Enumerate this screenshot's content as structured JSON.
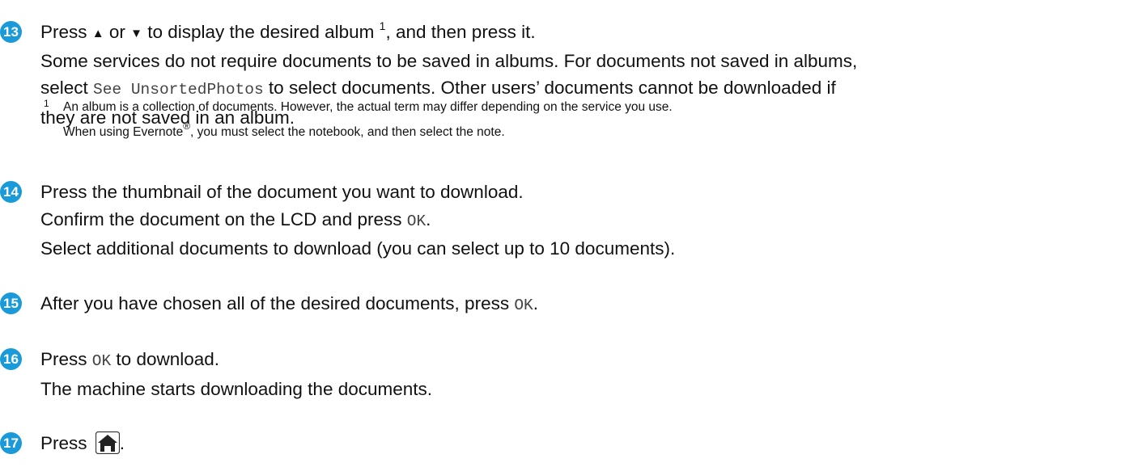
{
  "step13": {
    "number": "13",
    "l1_a": "Press ",
    "up_glyph": "▲",
    "l1_b": " or ",
    "down_glyph": "▼",
    "l1_c": " to display the desired album ",
    "l1_sup": "1",
    "l1_d": ", and then press it.",
    "l2": "Some services do not require documents to be saved in albums. For documents not saved in albums,",
    "l3_a": "select ",
    "l3_code": "See UnsortedPhotos",
    "l3_b": " to select documents. Other users’ documents cannot be downloaded if",
    "l4": "they are not saved in an album."
  },
  "footnote": {
    "number": "1",
    "line1": "An album is a collection of documents. However, the actual term may differ depending on the service you use.",
    "line2_a": "When using Evernote",
    "line2_reg": "®",
    "line2_b": ", you must select the notebook, and then select the note."
  },
  "step14": {
    "number": "14",
    "l1": "Press the thumbnail of the document you want to download.",
    "l2_a": "Confirm the document on the LCD and press ",
    "l2_code": "OK",
    "l2_b": ".",
    "l3": "Select additional documents to download (you can select up to 10 documents)."
  },
  "step15": {
    "number": "15",
    "l1_a": "After you have chosen all of the desired documents, press ",
    "l1_code": "OK",
    "l1_b": "."
  },
  "step16": {
    "number": "16",
    "l1_a": "Press ",
    "l1_code": "OK",
    "l1_b": " to download.",
    "l2": "The machine starts downloading the documents."
  },
  "step17": {
    "number": "17",
    "l1_a": "Press ",
    "icon": "home-icon",
    "l1_b": "."
  },
  "colors": {
    "badge": "#1a9ad9",
    "text": "#111111",
    "code": "#444444"
  }
}
